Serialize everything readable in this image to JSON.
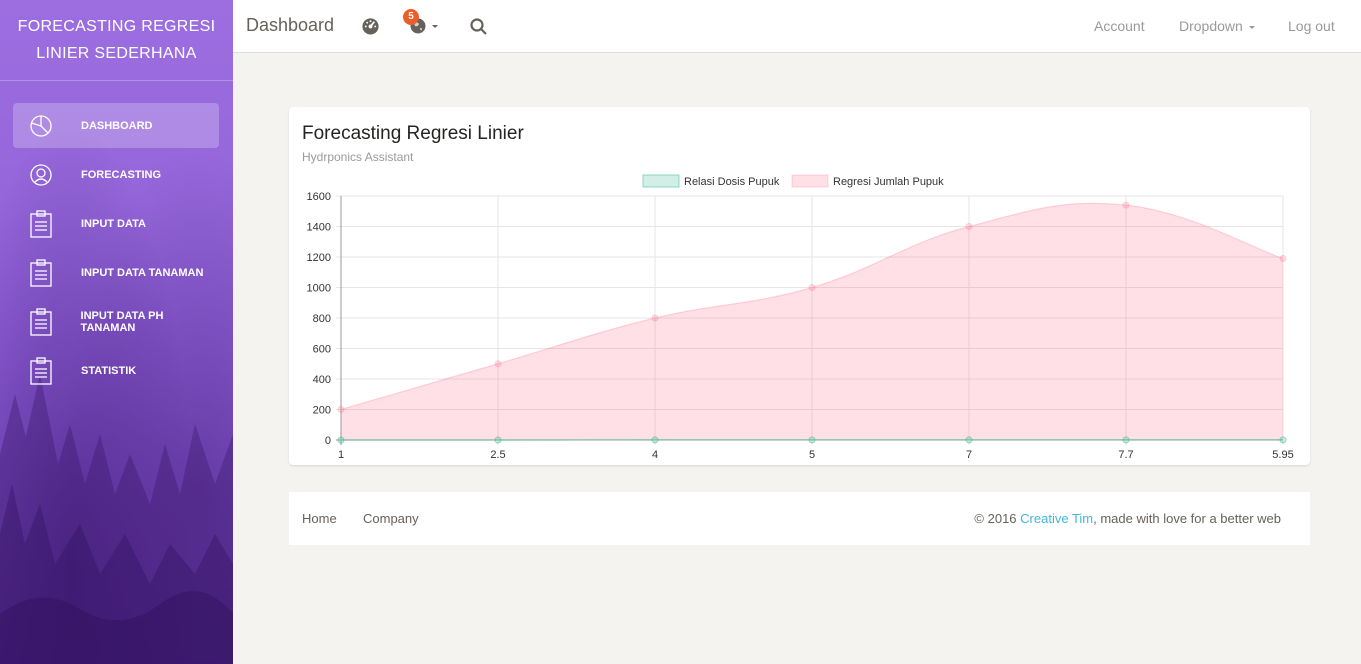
{
  "sidebar": {
    "brand": "FORECASTING REGRESI LINIER SEDERHANA",
    "items": [
      {
        "label": "DASHBOARD",
        "icon": "pie-chart-icon",
        "active": true
      },
      {
        "label": "FORECASTING",
        "icon": "user-icon",
        "active": false
      },
      {
        "label": "INPUT DATA",
        "icon": "clipboard-icon",
        "active": false
      },
      {
        "label": "INPUT DATA TANAMAN",
        "icon": "clipboard-icon",
        "active": false
      },
      {
        "label": "INPUT DATA PH TANAMAN",
        "icon": "clipboard-icon",
        "active": false
      },
      {
        "label": "STATISTIK",
        "icon": "clipboard-icon",
        "active": false
      }
    ]
  },
  "topbar": {
    "title": "Dashboard",
    "notification_count": "5",
    "links": {
      "account": "Account",
      "dropdown": "Dropdown",
      "logout": "Log out"
    }
  },
  "card": {
    "title": "Forecasting Regresi Linier",
    "subtitle": "Hydrponics Assistant"
  },
  "chart_data": {
    "type": "area",
    "categories": [
      "1",
      "2.5",
      "4",
      "5",
      "7",
      "7.7",
      "5.95"
    ],
    "ylim": [
      0,
      1600
    ],
    "yticks": [
      "0",
      "200",
      "400",
      "600",
      "800",
      "1000",
      "1200",
      "1400",
      "1600"
    ],
    "series": [
      {
        "name": "Relasi Dosis Pupuk",
        "values": [
          0,
          0,
          1,
          1,
          1,
          1,
          1
        ],
        "color": "#4bc0a0"
      },
      {
        "name": "Regresi Jumlah Pupuk",
        "values": [
          200,
          500,
          800,
          1000,
          1400,
          1540,
          1190
        ],
        "color": "#ff6384"
      }
    ],
    "grid": true,
    "legend": "top"
  },
  "footer": {
    "home": "Home",
    "company": "Company",
    "copy_prefix": "© 2016 ",
    "copy_link": "Creative Tim",
    "copy_suffix": ", made with love for a better web"
  },
  "colors": {
    "sidebar": "#9266d8",
    "accent": "#41b7d8",
    "badge": "#eb5e28"
  }
}
